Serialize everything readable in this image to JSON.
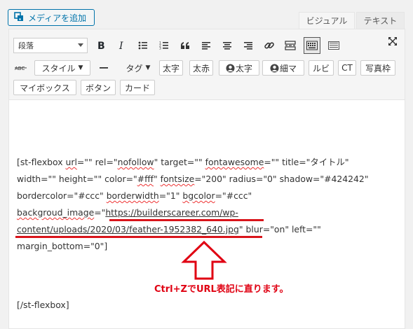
{
  "header": {
    "add_media_label": "メディアを追加",
    "tab_visual": "ビジュアル",
    "tab_text": "テキスト"
  },
  "toolbar": {
    "format_select_value": "段落",
    "row2": {
      "style_label": "スタイル",
      "tag_label": "タグ",
      "bold_jp": "太字",
      "bold_red": "太赤",
      "icon_bold": "太字",
      "icon_narrow": "細マ",
      "ruby": "ルビ",
      "ct": "CT",
      "photo_frame": "写真枠"
    },
    "row3": {
      "my_box": "マイボックス",
      "button": "ボタン",
      "card": "カード"
    }
  },
  "content": {
    "l1": {
      "a": "[st-flexbox ",
      "b": "url",
      "c": "=\"\" rel=\"",
      "d": "nofollow",
      "e": "\" target=\"\" ",
      "f": "fontawesome",
      "g": "=\"\" title=\"タイトル\""
    },
    "l2": {
      "a": "width=\"\" height=\"\" color=\"",
      "b": "#fff",
      "c": "\" ",
      "d": "fontsize",
      "e": "=\"200\" radius=\"0\" shadow=\"#424242\""
    },
    "l3": {
      "a": "bordercolor=\"#ccc\" ",
      "b": "borderwidth",
      "c": "=\"1\" ",
      "d": "bgcolor",
      "e": "=\"#ccc\""
    },
    "l4": {
      "a": "backgroud_image",
      "b": "=\"",
      "c": "https://builderscareer.com/wp-"
    },
    "l5": {
      "a": "content/uploads/2020/03/feather-1952382_640.jpg",
      "b": "\" blur=\"on\" left=\"\""
    },
    "l6": "margin_bottom=\"0\"]",
    "closing": "[/st-flexbox]"
  },
  "annotation": "Ctrl+ZでURL表記に直ります。",
  "colors": {
    "accent": "#0073aa",
    "annotation": "#e00012"
  }
}
